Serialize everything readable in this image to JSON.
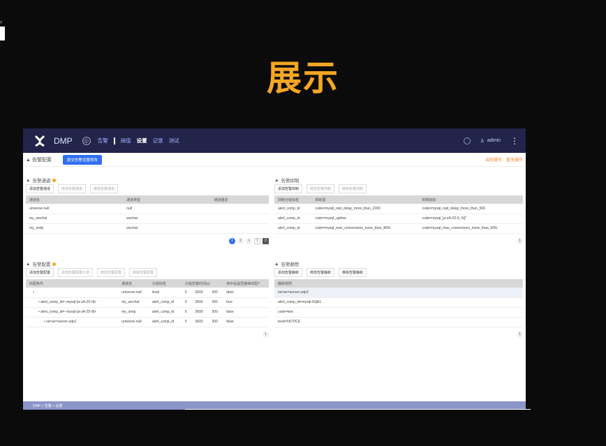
{
  "slide": {
    "title": "展示",
    "corner_text": "Y"
  },
  "topnav": {
    "brand": "DMP",
    "items": [
      "告警",
      "阈值",
      "设置",
      "记录",
      "测试"
    ],
    "active_index": 2,
    "user": "admin"
  },
  "header": {
    "title": "告警配置",
    "submit_button": "提交告警设置修改",
    "op_hint": "当前操作：暂无操作"
  },
  "channels": {
    "title": "告警通道",
    "buttons": [
      "添加告警通道",
      "修改告警通道",
      "移除告警通道"
    ],
    "columns": [
      "通道名",
      "通道类型",
      "通道描述"
    ],
    "rows": [
      [
        "universe-null",
        "null",
        ""
      ],
      [
        "my_wechat",
        "wechat",
        ""
      ],
      [
        "my_smtp",
        "wechat",
        ""
      ]
    ],
    "pager": [
      "1",
      "2",
      ">",
      "1",
      "2"
    ]
  },
  "suppress": {
    "title": "告警抑制",
    "buttons": [
      "添加告警抑制",
      "修改告警抑制",
      "移除告警抑制"
    ],
    "columns": [
      "抑制分组标签",
      "抑制源",
      "抑制目标"
    ],
    "rows": [
      [
        "alert_comp_id",
        "code=mysql_repl_delay_more_than_1000",
        "code=mysql_repl_delay_more_than_500"
      ],
      [
        "alert_comp_id",
        "code=mysql_uptime",
        "code=mysql_[a-zA-Z0-9_%]*"
      ],
      [
        "alert_comp_id",
        "code=mysql_max_connections_more_than_80%",
        "code=mysql_max_connections_more_than_60%"
      ]
    ],
    "pager": [
      "1"
    ]
  },
  "config": {
    "title": "告警配置",
    "buttons": [
      "添加告警配置",
      "添加告警配置子项",
      "修改告警配置",
      "移除告警配置"
    ],
    "columns": [
      "匹配条件",
      "通道名",
      "分组标签",
      "分组告警时间(s)",
      "",
      "",
      "命中后是否继续匹配?"
    ],
    "rows": [
      [
        "•",
        "universe-null",
        "level",
        "5",
        "3600",
        "300",
        "false"
      ],
      [
        "• alert_comp_id=~mysql-[a-zA-Z0-9]+",
        "my_wechat",
        "alert_comp_id",
        "5",
        "3600",
        "300",
        "true"
      ],
      [
        "• alert_comp_id=~mysql-[a-zA-Z0-9]+",
        "my_smtp",
        "alert_comp_id",
        "5",
        "3600",
        "300",
        "false"
      ],
      [
        "• server=server-udp1",
        "universe-null",
        "alert_comp_id",
        "5",
        "3600",
        "300",
        "false"
      ]
    ],
    "pager": [
      "1"
    ]
  },
  "silence": {
    "title": "告警静默",
    "buttons": [
      "添加告警静默",
      "修改告警静默",
      "移除告警静默"
    ],
    "columns": [
      "静默规则"
    ],
    "rows": [
      [
        "server=server-udp3"
      ],
      [
        "alert_comp_id=mysql-93jik1"
      ],
      [
        "code=test"
      ],
      [
        "level=NOTICE"
      ]
    ],
    "pager": [
      "1"
    ]
  },
  "breadcrumb": "DMP  >  告警  >  设置"
}
